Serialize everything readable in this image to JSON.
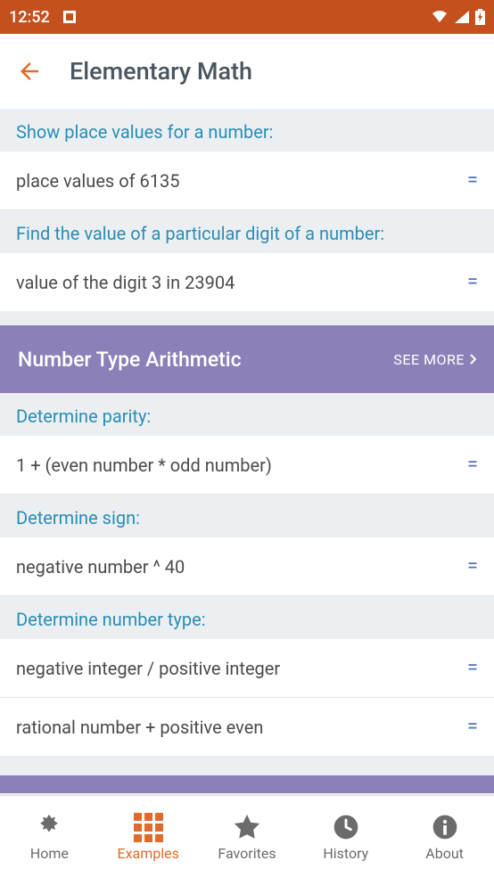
{
  "status": {
    "time": "12:52"
  },
  "header": {
    "title": "Elementary Math"
  },
  "sections": {
    "top": {
      "sub1": "Show place values for a number:",
      "row1": "place values of 6135",
      "sub2": "Find the value of a particular digit of a number:",
      "row2": "value of the digit 3 in 23904"
    },
    "arith": {
      "title": "Number Type Arithmetic",
      "seeMore": "SEE MORE",
      "sub1": "Determine parity:",
      "row1": "1 + (even number * odd number)",
      "sub2": "Determine sign:",
      "row2": "negative number ^ 40",
      "sub3": "Determine number type:",
      "row3": "negative integer / positive integer",
      "row4": "rational number + positive even"
    }
  },
  "equals": "=",
  "nav": {
    "home": "Home",
    "examples": "Examples",
    "favorites": "Favorites",
    "history": "History",
    "about": "About"
  }
}
